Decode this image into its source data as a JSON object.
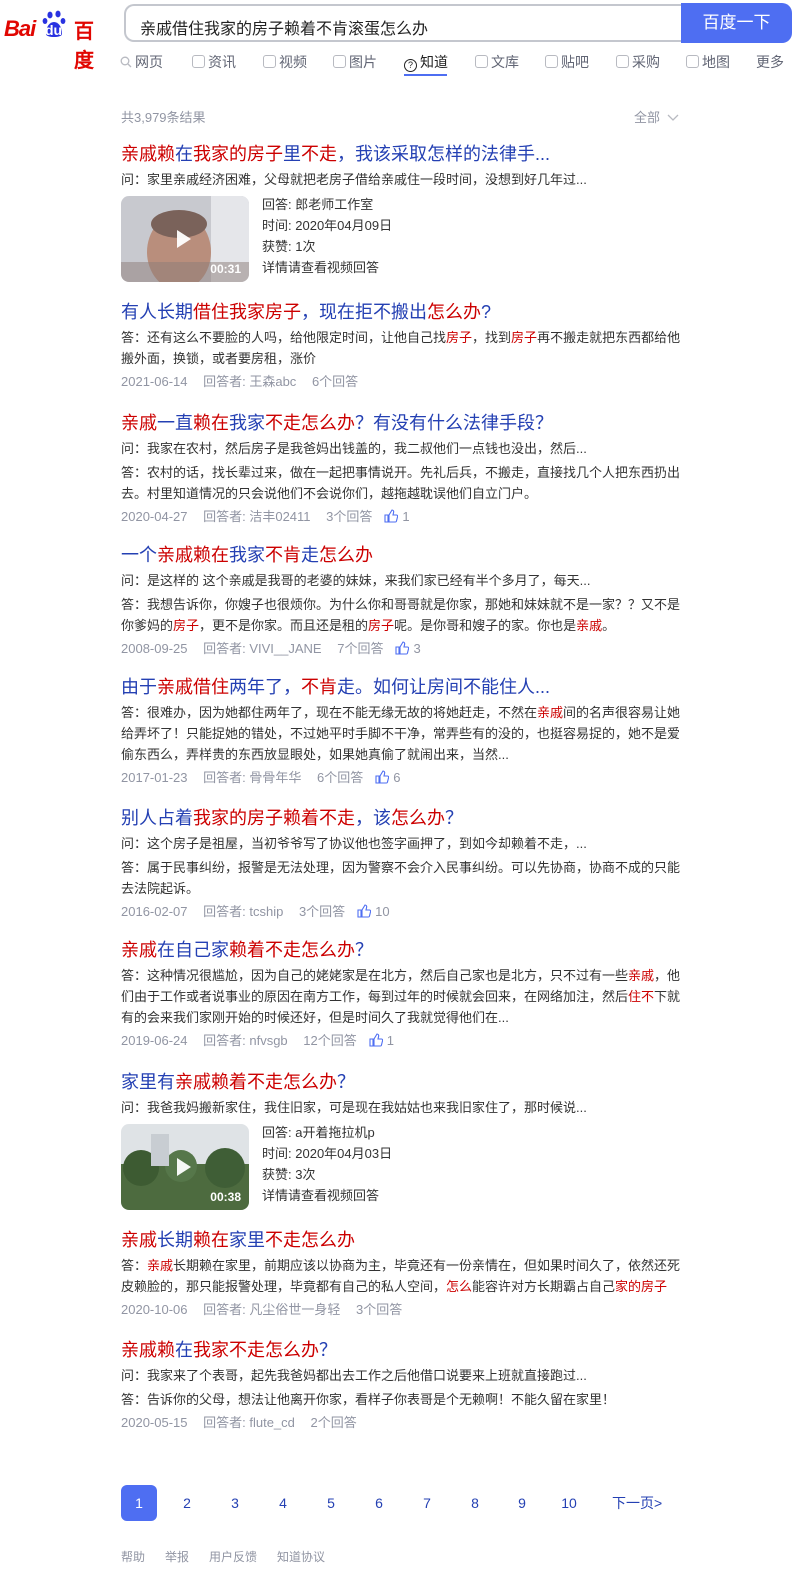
{
  "brand": {
    "latin": "Bai",
    "du": "du",
    "cn": "百度",
    "color": "#e10601"
  },
  "search": {
    "query": "亲戚借住我家的房子赖着不肯滚蛋怎么办",
    "button": "百度一下"
  },
  "tabs": [
    {
      "label": "网页",
      "icon": "search-icon"
    },
    {
      "label": "资讯",
      "icon": "news-icon"
    },
    {
      "label": "视频",
      "icon": "video-icon"
    },
    {
      "label": "图片",
      "icon": "image-icon"
    },
    {
      "label": "知道",
      "icon": "question-icon",
      "active": true
    },
    {
      "label": "文库",
      "icon": "doc-icon"
    },
    {
      "label": "贴吧",
      "icon": "tieba-icon"
    },
    {
      "label": "采购",
      "icon": "shop-icon"
    },
    {
      "label": "地图",
      "icon": "map-icon"
    },
    {
      "label": "更多",
      "icon": ""
    }
  ],
  "result_count": "共3,979条结果",
  "filter": "全部",
  "results": [
    {
      "title_html": "<em>亲戚赖</em>在<em>我家的房子</em>里<em>不走</em>，我该采取怎样的法律手...",
      "lines_html": [
        "问：家里亲戚经济困难，父母就把老房子借给亲戚住一段时间，没想到好几年过..."
      ],
      "video": {
        "duration": "00:31",
        "answer_label": "回答:",
        "answerer": "郎老师工作室",
        "time_label": "时间:",
        "time": "2020年04月09日",
        "likes_label": "获赞:",
        "likes": "1次",
        "more": "详情请查看视频回答"
      }
    },
    {
      "title_html": "有人长期<em>借住我家房子</em>，现在拒不搬出<em>怎么办</em>?",
      "lines_html": [
        "答：还有这么不要脸的人吗，给他限定时间，让他自己找<em>房子</em>，找到<em>房子</em>再不搬走就把东西都给他搬外面，换锁，或者要房租，涨价"
      ],
      "date": "2021-06-14",
      "answerer": "回答者: 王森abc",
      "answers": "6个回答"
    },
    {
      "title_html": "<em>亲戚</em>一直<em>赖在</em>我家<em>不走怎么办</em>？有没有什么法律手段？",
      "lines_html": [
        "问：我家在农村，然后房子是我爸妈出钱盖的，我二叔他们一点钱也没出，然后...",
        "答：农村的话，找长辈过来，做在一起把事情说开。先礼后兵，不搬走，直接找几个人把东西扔出去。村里知道情况的只会说他们不会说你们，越拖越耽误他们自立门户。"
      ],
      "date": "2020-04-27",
      "answerer": "回答者: 洁丰02411",
      "answers": "3个回答",
      "likes": "1"
    },
    {
      "title_html": "一个<em>亲戚赖在</em>我家<em>不肯</em>走<em>怎么办</em>",
      "lines_html": [
        "问：是这样的 这个亲戚是我哥的老婆的妹妹，来我们家已经有半个多月了，每天...",
        "答：我想告诉你，你嫂子也很烦你。为什么你和哥哥就是你家，那她和妹妹就不是一家？？又不是你爹妈的<em>房子</em>，更不是你家。而且还是租的<em>房子</em>呢。是你哥和嫂子的家。你也是<em>亲戚</em>。"
      ],
      "date": "2008-09-25",
      "answerer": "回答者: VIVI__JANE",
      "answers": "7个回答",
      "likes": "3"
    },
    {
      "title_html": "由于<em>亲戚借住</em>两年了，<em>不肯</em>走。如何让房间不能住人...",
      "lines_html": [
        "答：很难办，因为她都住两年了，现在不能无缘无故的将她赶走，不然在<em>亲戚</em>间的名声很容易让她给弄坏了！只能捉她的错处，不过她平时手脚不干净，常弄些有的没的，也挺容易捉的，她不是爱偷东西么，弄样贵的东西放显眼处，如果她真偷了就闹出来，当然..."
      ],
      "date": "2017-01-23",
      "answerer": "回答者: 骨骨年华",
      "answers": "6个回答",
      "likes": "6"
    },
    {
      "title_html": "别人占着<em>我家的房子赖着不走</em>，该<em>怎么办</em>？",
      "lines_html": [
        "问：这个房子是祖屋，当初爷爷写了协议他也签字画押了，到如今却赖着不走，...",
        "答：属于民事纠纷，报警是无法处理，因为警察不会介入民事纠纷。可以先协商，协商不成的只能去法院起诉。"
      ],
      "date": "2016-02-07",
      "answerer": "回答者: tcship",
      "answers": "3个回答",
      "likes": "10"
    },
    {
      "title_html": "<em>亲戚</em>在自己家<em>赖着不走怎么办</em>？",
      "lines_html": [
        "答：这种情况很尴尬，因为自己的姥姥家是在北方，然后自己家也是北方，只不过有一些<em>亲戚</em>，他们由于工作或者说事业的原因在南方工作，每到过年的时候就会回来，在网络加注，然后<em>住不</em>下就有的会来我们家刚开始的时候还好，但是时间久了我就觉得他们在..."
      ],
      "date": "2019-06-24",
      "answerer": "回答者: nfvsgb",
      "answers": "12个回答",
      "likes": "1"
    },
    {
      "title_html": "家里有<em>亲戚赖着不走怎么办</em>？",
      "lines_html": [
        "问：我爸我妈搬新家住，我住旧家，可是现在我姑姑也来我旧家住了，那时候说..."
      ],
      "video": {
        "duration": "00:38",
        "answer_label": "回答:",
        "answerer": "a开着拖拉机p",
        "time_label": "时间:",
        "time": "2020年04月03日",
        "likes_label": "获赞:",
        "likes": "3次",
        "more": "详情请查看视频回答"
      }
    },
    {
      "title_html": "<em>亲戚</em>长期<em>赖在</em>家里<em>不走怎么办</em>",
      "lines_html": [
        "答：<em>亲戚</em>长期赖在家里，前期应该以协商为主，毕竟还有一份亲情在，但如果时间久了，依然还死皮赖脸的，那只能报警处理，毕竟都有自己的私人空间，<em>怎么</em>能容许对方长期霸占自己<em>家的房子</em>"
      ],
      "date": "2020-10-06",
      "answerer": "回答者: 凡尘俗世一身轻",
      "answers": "3个回答"
    },
    {
      "title_html": "<em>亲戚赖</em>在<em>我家不走怎么办</em>？",
      "lines_html": [
        "问：我家来了个表哥，起先我爸妈都出去工作之后他借口说要来上班就直接跑过...",
        "答：告诉你的父母，想法让他离开你家，看样子你表哥是个无赖啊！不能久留在家里！"
      ],
      "date": "2020-05-15",
      "answerer": "回答者: flute_cd",
      "answers": "2个回答"
    }
  ],
  "pagination": {
    "pages": [
      "1",
      "2",
      "3",
      "4",
      "5",
      "6",
      "7",
      "8",
      "9",
      "10"
    ],
    "current": "1",
    "next": "下一页>"
  },
  "footer": [
    "帮助",
    "举报",
    "用户反馈",
    "知道协议"
  ],
  "colors": {
    "link": "#2440b3",
    "highlight": "#cc0000",
    "accent": "#4e6ef2",
    "meta": "#9195a3"
  }
}
